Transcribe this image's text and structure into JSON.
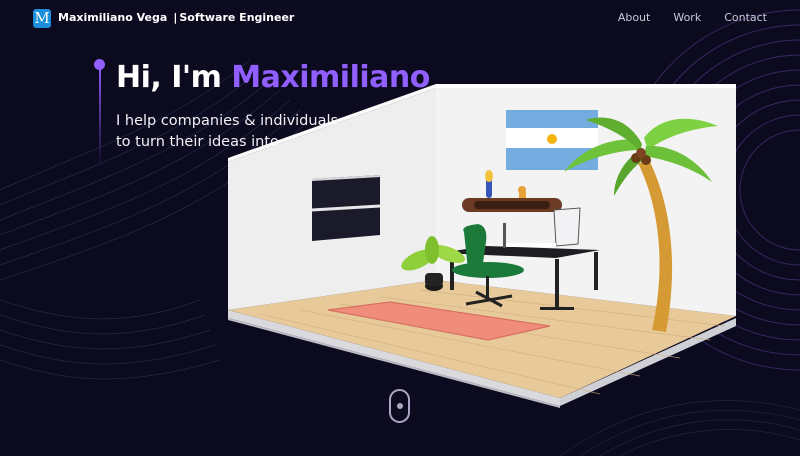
{
  "header": {
    "logo_letter": "M",
    "brand_name": "Maximiliano Vega",
    "brand_separator": "|",
    "brand_role": "Software Engineer",
    "nav": [
      "About",
      "Work",
      "Contact"
    ]
  },
  "hero": {
    "greeting": "Hi, I'm",
    "name": "Maximiliano",
    "subtitle_line1": "I help companies & individuals",
    "subtitle_line2": "to turn their ideas into great software."
  },
  "colors": {
    "background": "#0b0a1f",
    "accent": "#915eff",
    "logo_bg": "#1c8fdc"
  },
  "icons": {
    "scroll": "mouse-scroll-icon",
    "logo": "m-logo-icon"
  }
}
